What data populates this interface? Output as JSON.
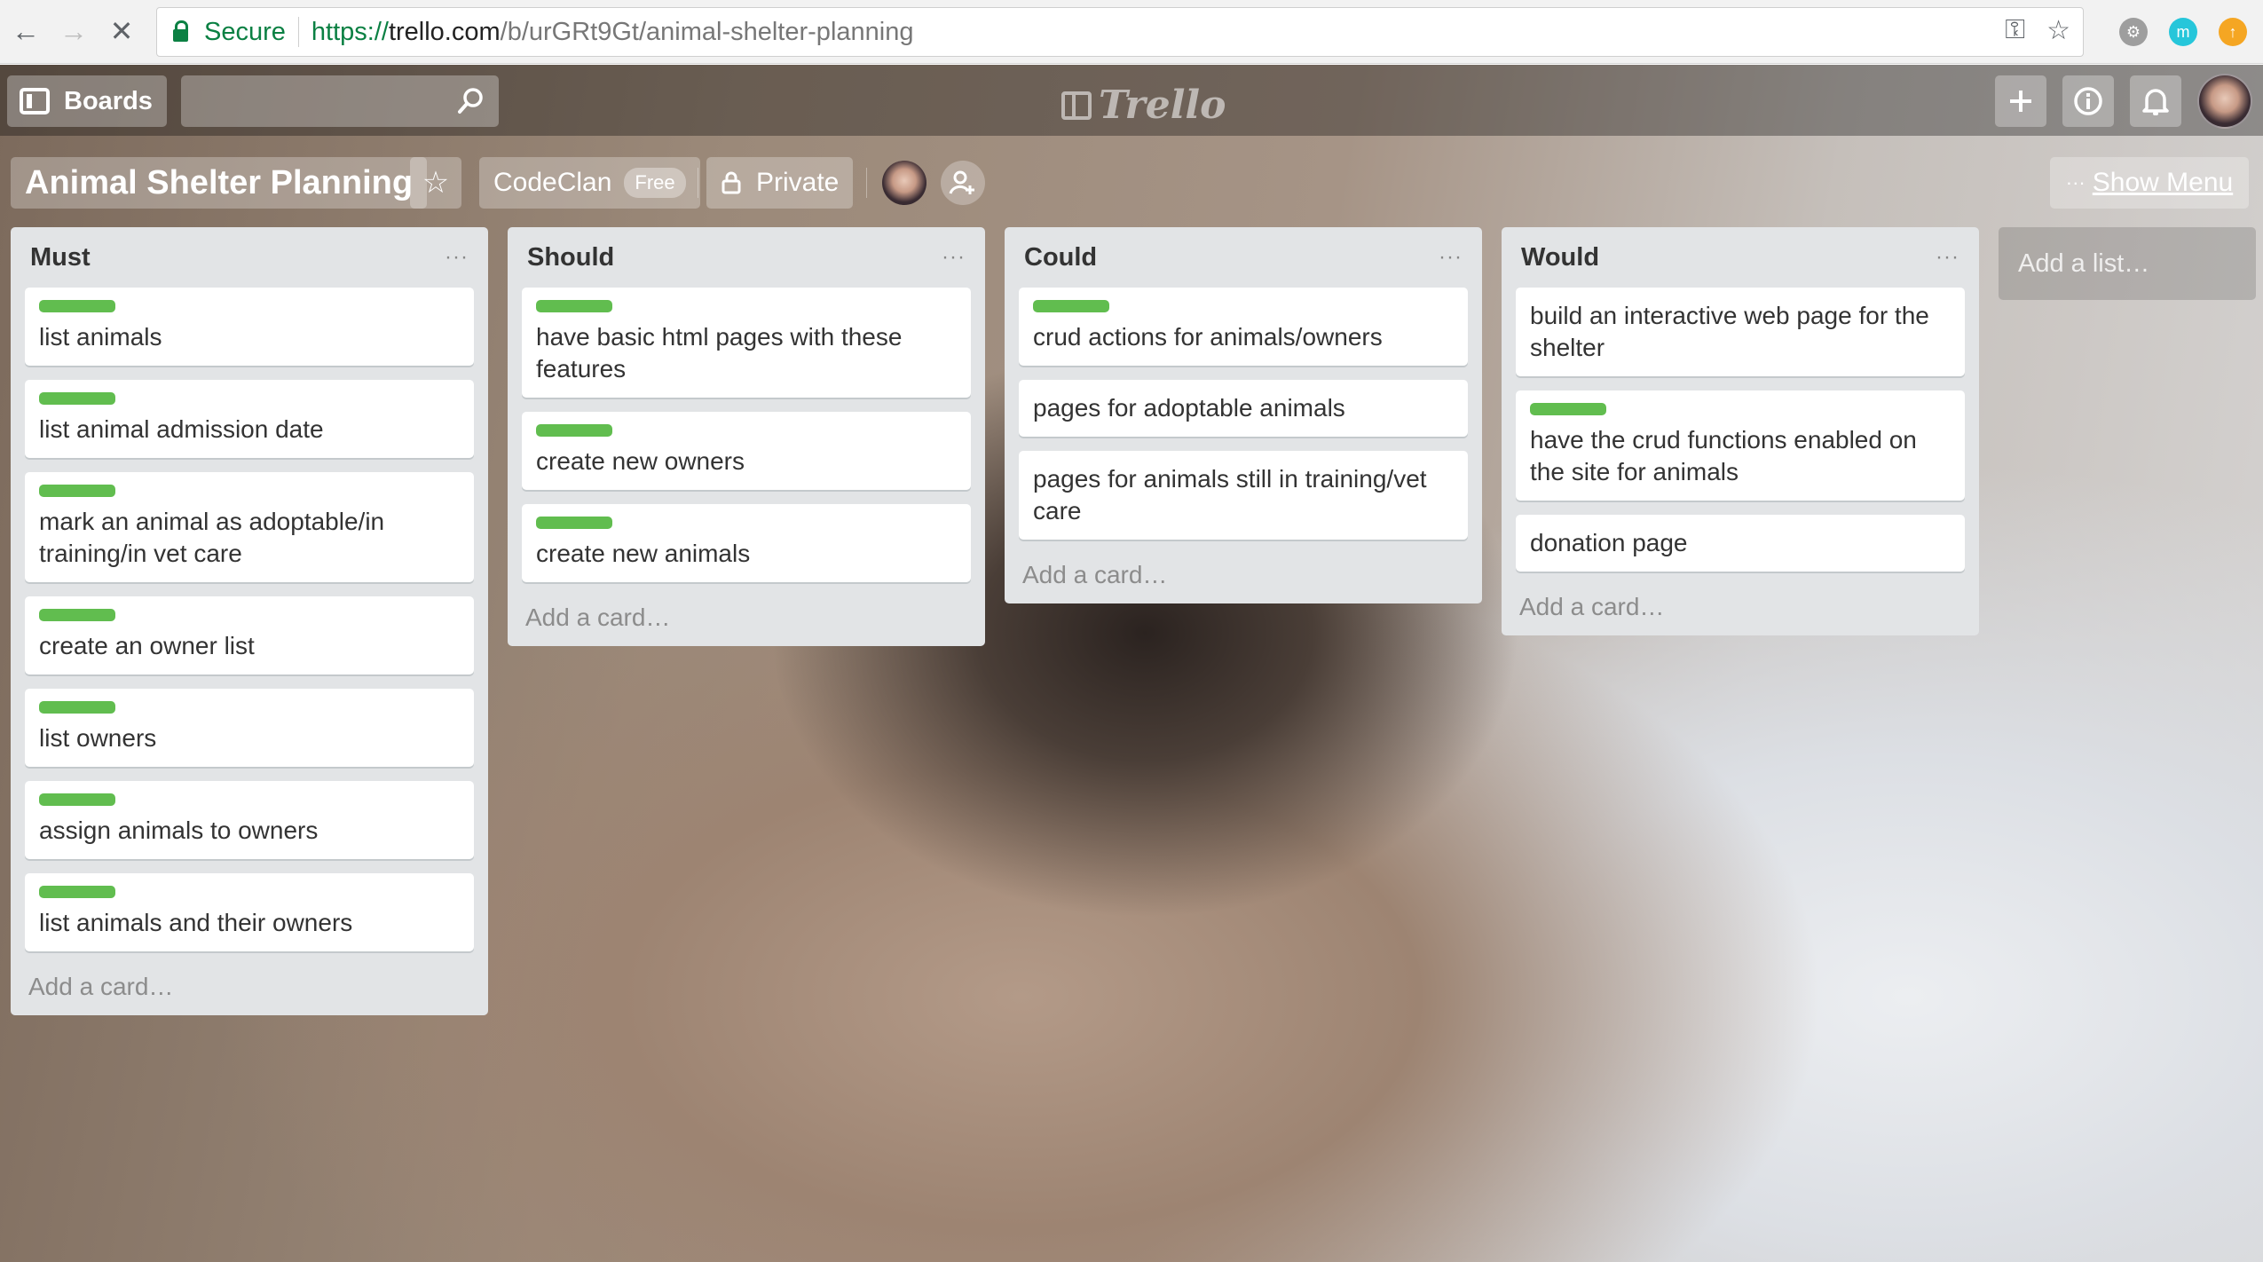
{
  "browser": {
    "secure_label": "Secure",
    "url_scheme": "https://",
    "url_host": "trello.com",
    "url_path": "/b/urGRt9Gt/animal-shelter-planning",
    "icons": [
      "back-arrow-icon",
      "forward-arrow-icon",
      "stop-loading-icon",
      "key-icon",
      "star-icon",
      "settings-gear-icon"
    ]
  },
  "header": {
    "boards_label": "Boards",
    "search_placeholder": "",
    "logo_text": "Trello",
    "icons": [
      "plus-icon",
      "info-icon",
      "bell-icon"
    ]
  },
  "board": {
    "title": "Animal Shelter Planning",
    "team": "CodeClan",
    "team_badge": "Free",
    "visibility": "Private",
    "show_menu_dots": "···",
    "show_menu_label": "Show Menu"
  },
  "lists": [
    {
      "title": "Must",
      "menu": "···",
      "cards": [
        {
          "label": true,
          "text": "list animals"
        },
        {
          "label": true,
          "text": "list animal admission date"
        },
        {
          "label": true,
          "text": "mark an animal as adoptable/in training/in vet care"
        },
        {
          "label": true,
          "text": "create an owner list"
        },
        {
          "label": true,
          "text": "list owners"
        },
        {
          "label": true,
          "text": "assign animals to owners"
        },
        {
          "label": true,
          "text": "list animals and their owners"
        }
      ],
      "add_card": "Add a card…"
    },
    {
      "title": "Should",
      "menu": "···",
      "cards": [
        {
          "label": true,
          "text": "have basic html pages with these features"
        },
        {
          "label": true,
          "text": "create new owners"
        },
        {
          "label": true,
          "text": "create new animals"
        }
      ],
      "add_card": "Add a card…"
    },
    {
      "title": "Could",
      "menu": "···",
      "cards": [
        {
          "label": true,
          "text": "crud actions for animals/owners"
        },
        {
          "label": false,
          "text": "pages for adoptable animals"
        },
        {
          "label": false,
          "text": "pages for animals still in training/vet care"
        }
      ],
      "add_card": "Add a card…"
    },
    {
      "title": "Would",
      "menu": "···",
      "cards": [
        {
          "label": false,
          "text": "build an interactive web page for the shelter"
        },
        {
          "label": true,
          "text": "have the crud functions enabled on the site for animals"
        },
        {
          "label": false,
          "text": "donation page"
        }
      ],
      "add_card": "Add a card…"
    }
  ],
  "add_list_label": "Add a list…",
  "colors": {
    "label_green": "#61bd4f",
    "list_bg": "#e2e4e6",
    "secure_green": "#0b8043"
  }
}
